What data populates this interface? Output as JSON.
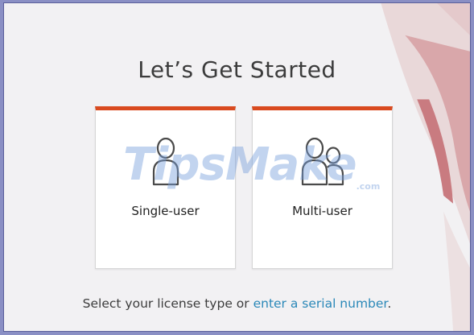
{
  "dialog": {
    "title": "Let’s Get Started"
  },
  "options": [
    {
      "label": "Single-user",
      "icon": "single-user-icon"
    },
    {
      "label": "Multi-user",
      "icon": "multi-user-icon"
    }
  ],
  "footer": {
    "text_before": "Select your license type or ",
    "link": "enter a serial number",
    "text_after": "."
  },
  "watermark": {
    "text": "TipsMake",
    "suffix": ".com"
  },
  "colors": {
    "accent": "#d94a1f",
    "link": "#2a88b8"
  }
}
